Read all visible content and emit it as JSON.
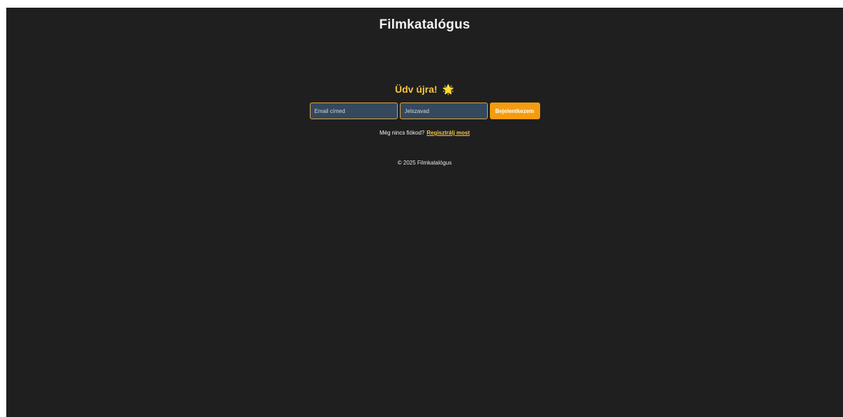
{
  "header": {
    "title": "Filmkatalógus"
  },
  "login": {
    "welcome": "Üdv újra!",
    "welcome_icon": "star-emoji",
    "welcome_glyph": "🌟",
    "email_placeholder": "Email címed",
    "email_value": "",
    "password_placeholder": "Jelszavad",
    "password_value": "",
    "submit_label": "Bejelentkezem",
    "no_account_text": "Még nincs fiókod?",
    "register_link": "Regisztrálj most"
  },
  "footer": {
    "copyright": "© 2025 Filmkatalógus"
  },
  "colors": {
    "background": "#1f1f1f",
    "accent": "#f39c12",
    "highlight": "#f5c542",
    "input_bg": "#34495e"
  }
}
